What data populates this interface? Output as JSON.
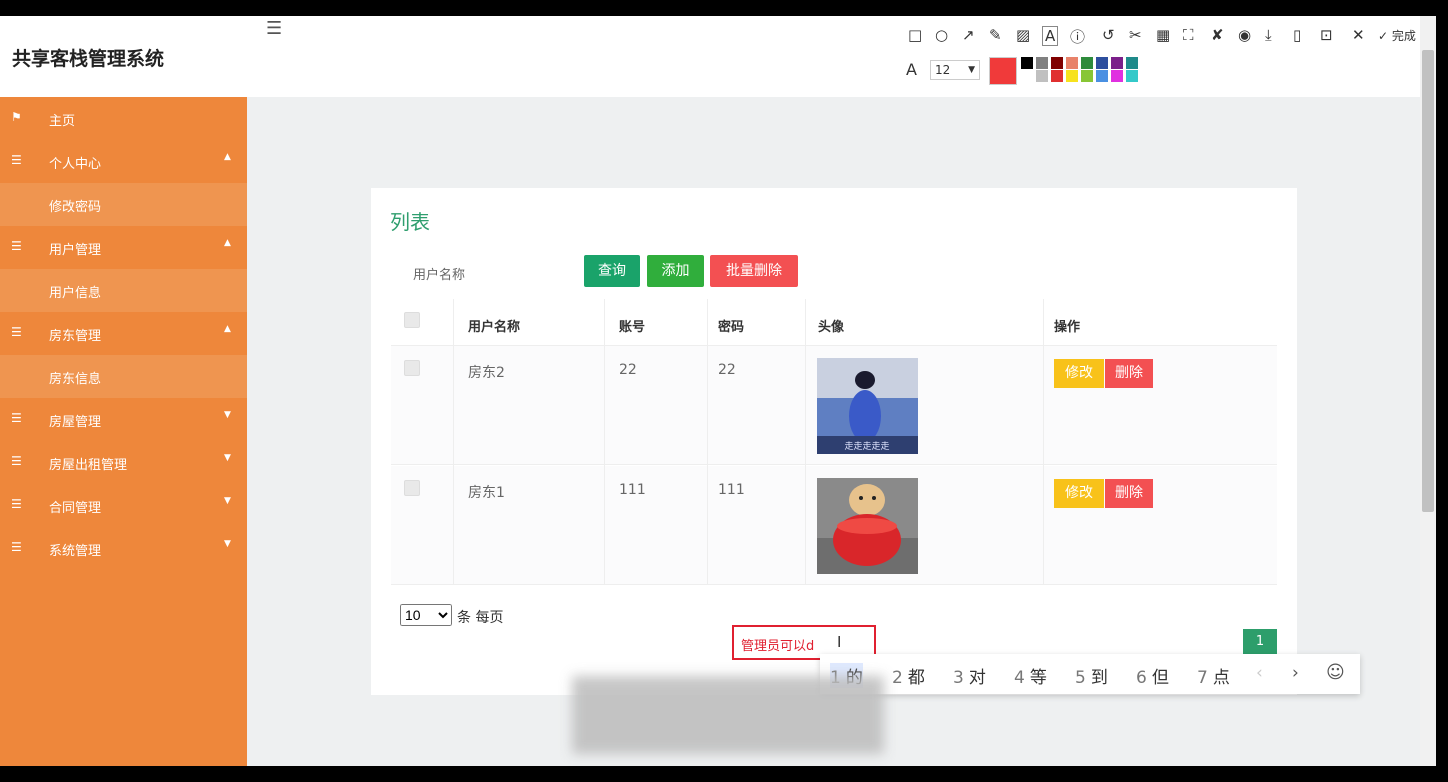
{
  "app": {
    "title": "共享客栈管理系统"
  },
  "sidebar": {
    "items": [
      {
        "label": "主页",
        "icon": "flag-icon",
        "caret": false,
        "sub": false
      },
      {
        "label": "个人中心",
        "icon": "list-icon",
        "caret": true,
        "sub": false
      },
      {
        "label": "修改密码",
        "icon": "",
        "caret": false,
        "sub": true
      },
      {
        "label": "用户管理",
        "icon": "list-icon",
        "caret": true,
        "sub": false
      },
      {
        "label": "用户信息",
        "icon": "",
        "caret": false,
        "sub": true
      },
      {
        "label": "房东管理",
        "icon": "list-icon",
        "caret": true,
        "sub": false
      },
      {
        "label": "房东信息",
        "icon": "",
        "caret": false,
        "sub": true
      },
      {
        "label": "房屋管理",
        "icon": "list-icon",
        "caret": true,
        "sub": false
      },
      {
        "label": "房屋出租管理",
        "icon": "list-icon",
        "caret": true,
        "sub": false
      },
      {
        "label": "合同管理",
        "icon": "list-icon",
        "caret": true,
        "sub": false
      },
      {
        "label": "系统管理",
        "icon": "list-icon",
        "caret": true,
        "sub": false
      }
    ]
  },
  "main": {
    "title": "列表",
    "search": {
      "label": "用户名称"
    },
    "buttons": {
      "query": "查询",
      "add": "添加",
      "batch_delete": "批量删除"
    },
    "table": {
      "columns": [
        "用户名称",
        "账号",
        "密码",
        "头像",
        "操作"
      ],
      "rows": [
        {
          "name": "房东2",
          "account": "22",
          "password": "22",
          "avatar_caption": "走走走走走",
          "edit": "修改",
          "delete": "删除"
        },
        {
          "name": "房东1",
          "account": "111",
          "password": "111",
          "avatar_caption": "",
          "edit": "修改",
          "delete": "删除"
        }
      ]
    },
    "pagination": {
      "page_size": "10",
      "per_page_text": "条 每页",
      "current_page": "1"
    }
  },
  "screenshot_toolbar": {
    "done_label": "完成",
    "font_size": "12",
    "current_color": "#f03a3a",
    "swatches_top": [
      "#000000",
      "#808080",
      "#800000",
      "#e8826a",
      "#2e8b3c",
      "#2e4f9e",
      "#7b1f8a",
      "#1f8a8a"
    ],
    "swatches_bottom": [
      "#ffffff",
      "#c0c0c0",
      "#e03030",
      "#f7e21e",
      "#88c635",
      "#4a90e2",
      "#e030e0",
      "#34c9c9"
    ]
  },
  "annotation": {
    "text": "管理员可以d"
  },
  "ime": {
    "candidates": [
      {
        "n": "1",
        "w": "的"
      },
      {
        "n": "2",
        "w": "都"
      },
      {
        "n": "3",
        "w": "对"
      },
      {
        "n": "4",
        "w": "等"
      },
      {
        "n": "5",
        "w": "到"
      },
      {
        "n": "6",
        "w": "但"
      },
      {
        "n": "7",
        "w": "点"
      }
    ]
  }
}
